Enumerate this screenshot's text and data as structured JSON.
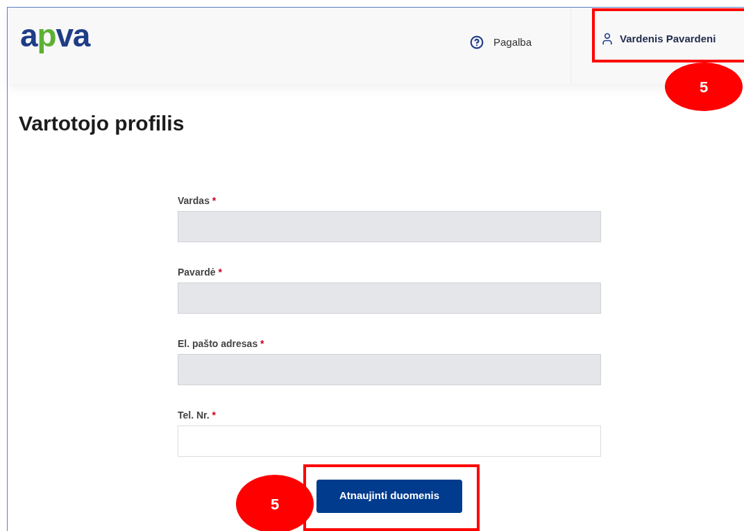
{
  "header": {
    "logo": [
      {
        "text": "a",
        "color": "#1f3d86"
      },
      {
        "text": "p",
        "color": "#5cb132"
      },
      {
        "text": "va",
        "color": "#1f3d86"
      }
    ],
    "help_link": "Pagalba",
    "user_name": "Vardenis Pavardeni"
  },
  "page_title": "Vartotojo profilis",
  "form": {
    "fields": [
      {
        "label": "Vardas",
        "required": "*",
        "disabled": true
      },
      {
        "label": "Pavardė",
        "required": "*",
        "disabled": true
      },
      {
        "label": "El. pašto adresas",
        "required": "*",
        "disabled": true
      },
      {
        "label": "Tel. Nr.",
        "required": "*",
        "disabled": false
      }
    ],
    "submit": "Atnaujinti duomenis"
  },
  "annotations": [
    {
      "label": "5"
    },
    {
      "label": "5"
    }
  ]
}
